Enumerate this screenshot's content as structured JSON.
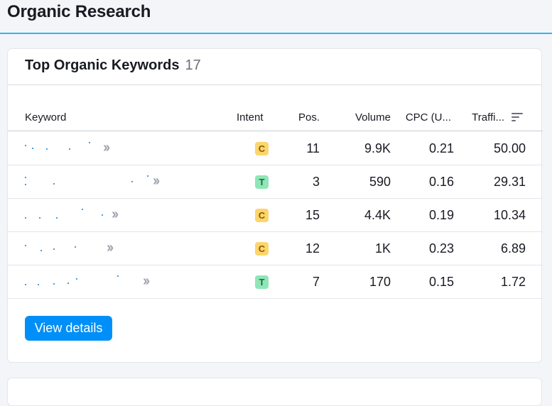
{
  "page": {
    "title": "Organic Research"
  },
  "card": {
    "title": "Top Organic Keywords",
    "count": "17",
    "columns": {
      "keyword": "Keyword",
      "intent": "Intent",
      "pos": "Pos.",
      "volume": "Volume",
      "cpc": "CPC (U...",
      "traffic": "Traffi..."
    },
    "rows": [
      {
        "intent": "C",
        "pos": "11",
        "volume": "9.9K",
        "cpc": "0.21",
        "traffic": "50.00"
      },
      {
        "intent": "T",
        "pos": "3",
        "volume": "590",
        "cpc": "0.16",
        "traffic": "29.31"
      },
      {
        "intent": "C",
        "pos": "15",
        "volume": "4.4K",
        "cpc": "0.19",
        "traffic": "10.34"
      },
      {
        "intent": "C",
        "pos": "12",
        "volume": "1K",
        "cpc": "0.23",
        "traffic": "6.89"
      },
      {
        "intent": "T",
        "pos": "7",
        "volume": "170",
        "cpc": "0.15",
        "traffic": "1.72"
      }
    ],
    "view_details_label": "View details",
    "colors": {
      "accent": "#008ff8",
      "intent_c": "#fdd56c",
      "intent_t": "#8fe6b6"
    }
  }
}
